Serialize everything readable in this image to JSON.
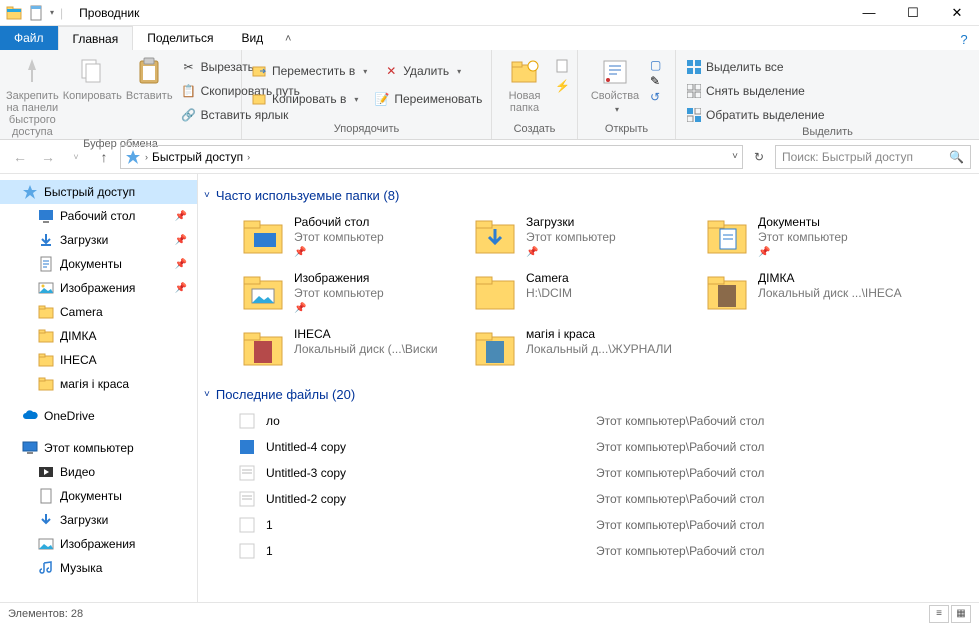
{
  "window": {
    "title": "Проводник"
  },
  "tabs": {
    "file": "Файл",
    "home": "Главная",
    "share": "Поделиться",
    "view": "Вид"
  },
  "ribbon": {
    "clipboard": {
      "label": "Буфер обмена",
      "pin": "Закрепить на панели\nбыстрого доступа",
      "copy": "Копировать",
      "paste": "Вставить",
      "cut": "Вырезать",
      "copypath": "Скопировать путь",
      "pastelink": "Вставить ярлык"
    },
    "organize": {
      "label": "Упорядочить",
      "moveto": "Переместить в",
      "copyto": "Копировать в",
      "delete": "Удалить",
      "rename": "Переименовать"
    },
    "new": {
      "label": "Создать",
      "newfolder": "Новая\nпапка"
    },
    "open": {
      "label": "Открыть",
      "properties": "Свойства"
    },
    "select": {
      "label": "Выделить",
      "selectall": "Выделить все",
      "selectnone": "Снять выделение",
      "invert": "Обратить выделение"
    }
  },
  "address": {
    "quick": "Быстрый доступ"
  },
  "search": {
    "placeholder": "Поиск: Быстрый доступ"
  },
  "nav": {
    "quick": "Быстрый доступ",
    "desktop": "Рабочий стол",
    "downloads": "Загрузки",
    "documents": "Документы",
    "pictures": "Изображения",
    "camera": "Camera",
    "dimka": "ДІМКА",
    "iheca": "IHECA",
    "magia": "магія і краса",
    "onedrive": "OneDrive",
    "thispc": "Этот компьютер",
    "video": "Видео",
    "docs2": "Документы",
    "dl2": "Загрузки",
    "pics2": "Изображения",
    "music": "Музыка"
  },
  "sections": {
    "frequent": "Часто используемые папки (8)",
    "recent": "Последние файлы (20)"
  },
  "folders": [
    {
      "name": "Рабочий стол",
      "loc": "Этот компьютер",
      "pin": true,
      "type": "desktop"
    },
    {
      "name": "Загрузки",
      "loc": "Этот компьютер",
      "pin": true,
      "type": "downloads"
    },
    {
      "name": "Документы",
      "loc": "Этот компьютер",
      "pin": true,
      "type": "documents"
    },
    {
      "name": "Изображения",
      "loc": "Этот компьютер",
      "pin": true,
      "type": "pictures"
    },
    {
      "name": "Camera",
      "loc": "H:\\DCIM",
      "pin": false,
      "type": "folder"
    },
    {
      "name": "ДІМКА",
      "loc": "Локальный диск ...\\IHECA",
      "pin": false,
      "type": "thumb"
    },
    {
      "name": "IHECA",
      "loc": "Локальный диск (...\\Виски",
      "pin": false,
      "type": "thumb2"
    },
    {
      "name": "магія і краса",
      "loc": "Локальный д...\\ЖУРНАЛИ",
      "pin": false,
      "type": "thumb3"
    }
  ],
  "files": [
    {
      "name": "ло",
      "loc": "Этот компьютер\\Рабочий стол"
    },
    {
      "name": "Untitled-4 copy",
      "loc": "Этот компьютер\\Рабочий стол"
    },
    {
      "name": "Untitled-3 copy",
      "loc": "Этот компьютер\\Рабочий стол"
    },
    {
      "name": "Untitled-2 copy",
      "loc": "Этот компьютер\\Рабочий стол"
    },
    {
      "name": "1",
      "loc": "Этот компьютер\\Рабочий стол"
    },
    {
      "name": "1",
      "loc": "Этот компьютер\\Рабочий стол"
    }
  ],
  "status": {
    "items": "Элементов: 28"
  }
}
